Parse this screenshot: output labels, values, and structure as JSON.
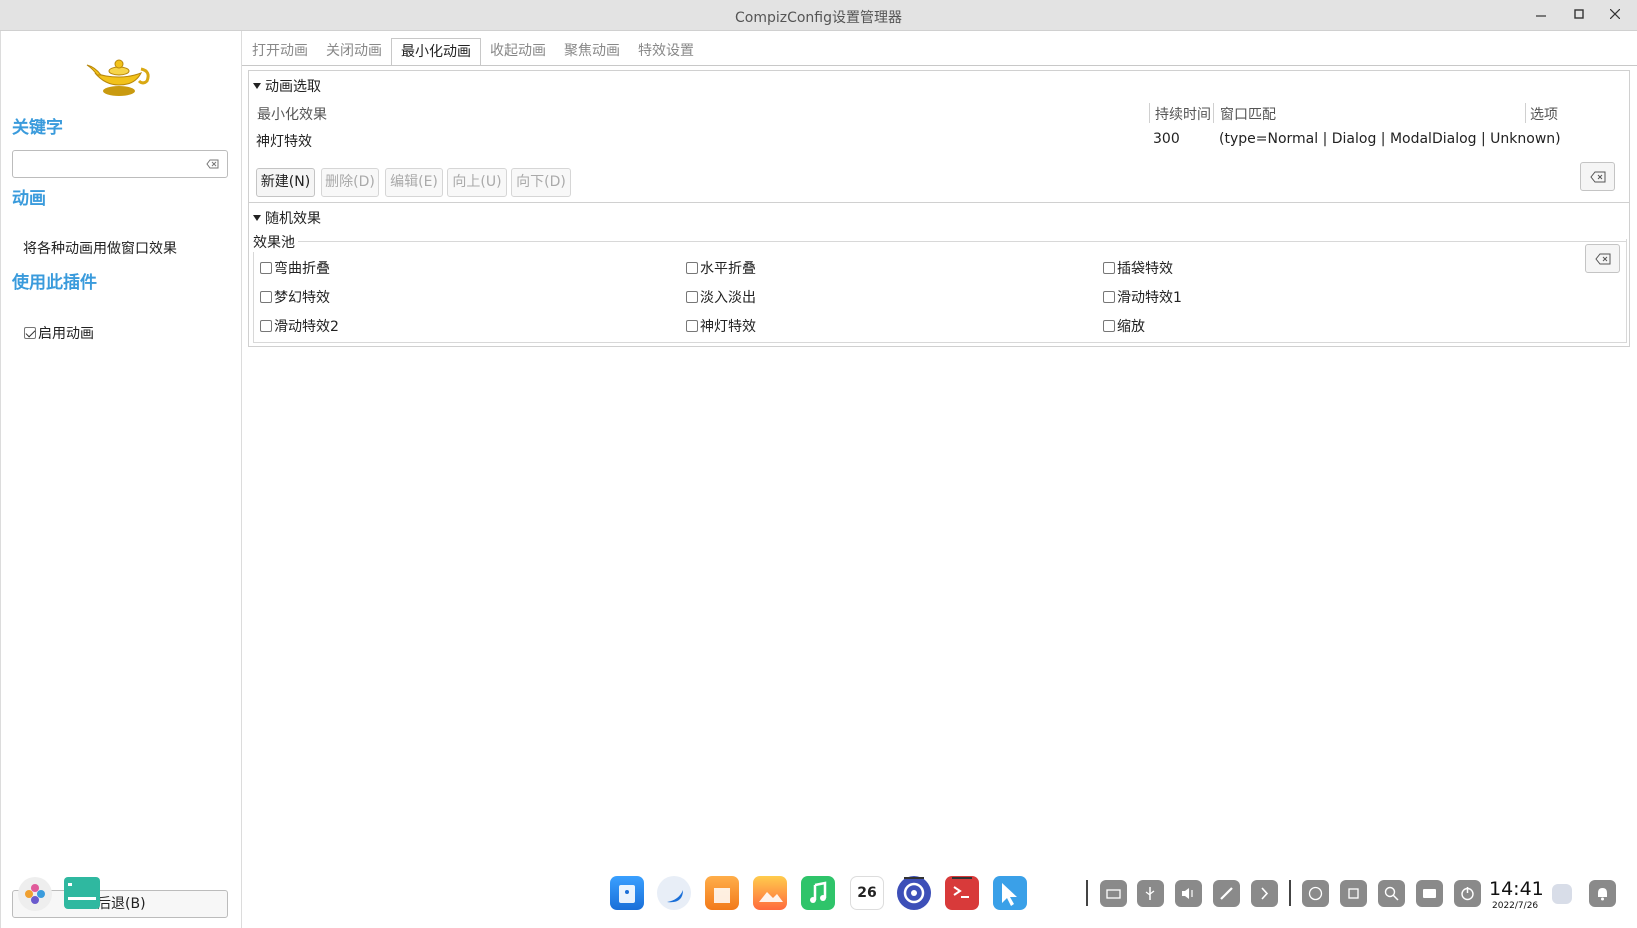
{
  "window": {
    "title": "CompizConfig设置管理器"
  },
  "sidebar": {
    "keyword_title": "关键字",
    "search": {
      "value": "",
      "placeholder": ""
    },
    "plugin_title": "动画",
    "plugin_desc": "将各种动画用做窗口效果",
    "use_plugin_title": "使用此插件",
    "enable_label": "启用动画",
    "enable_checked": true,
    "back_label": "后退(B)"
  },
  "tabs": [
    {
      "label": "打开动画",
      "active": false
    },
    {
      "label": "关闭动画",
      "active": false
    },
    {
      "label": "最小化动画",
      "active": true
    },
    {
      "label": "收起动画",
      "active": false
    },
    {
      "label": "聚焦动画",
      "active": false
    },
    {
      "label": "特效设置",
      "active": false
    }
  ],
  "animation_selection": {
    "header": "动画选取",
    "columns": [
      "最小化效果",
      "持续时间",
      "窗口匹配",
      "选项"
    ],
    "rows": [
      {
        "effect": "神灯特效",
        "duration": "300",
        "match": "(type=Normal | Dialog | ModalDialog | Unknown)",
        "options": ""
      }
    ],
    "buttons": {
      "new": "新建(N)",
      "delete": "删除(D)",
      "edit": "编辑(E)",
      "up": "向上(U)",
      "down": "向下(D)"
    }
  },
  "random_effects": {
    "header": "随机效果",
    "pool_label": "效果池",
    "effects": [
      {
        "label": "弯曲折叠",
        "checked": false
      },
      {
        "label": "水平折叠",
        "checked": false
      },
      {
        "label": "插袋特效",
        "checked": false
      },
      {
        "label": "梦幻特效",
        "checked": false
      },
      {
        "label": "淡入淡出",
        "checked": false
      },
      {
        "label": "滑动特效1",
        "checked": false
      },
      {
        "label": "滑动特效2",
        "checked": false
      },
      {
        "label": "神灯特效",
        "checked": false
      },
      {
        "label": "缩放",
        "checked": false
      }
    ]
  },
  "taskbar": {
    "calendar_day": "26",
    "time": "14:41",
    "date": "2022/7/26"
  },
  "colors": {
    "accent": "#3a9bdc",
    "titlebar_bg": "#e3e3e3",
    "tray_icon": "#8a8a8a"
  }
}
